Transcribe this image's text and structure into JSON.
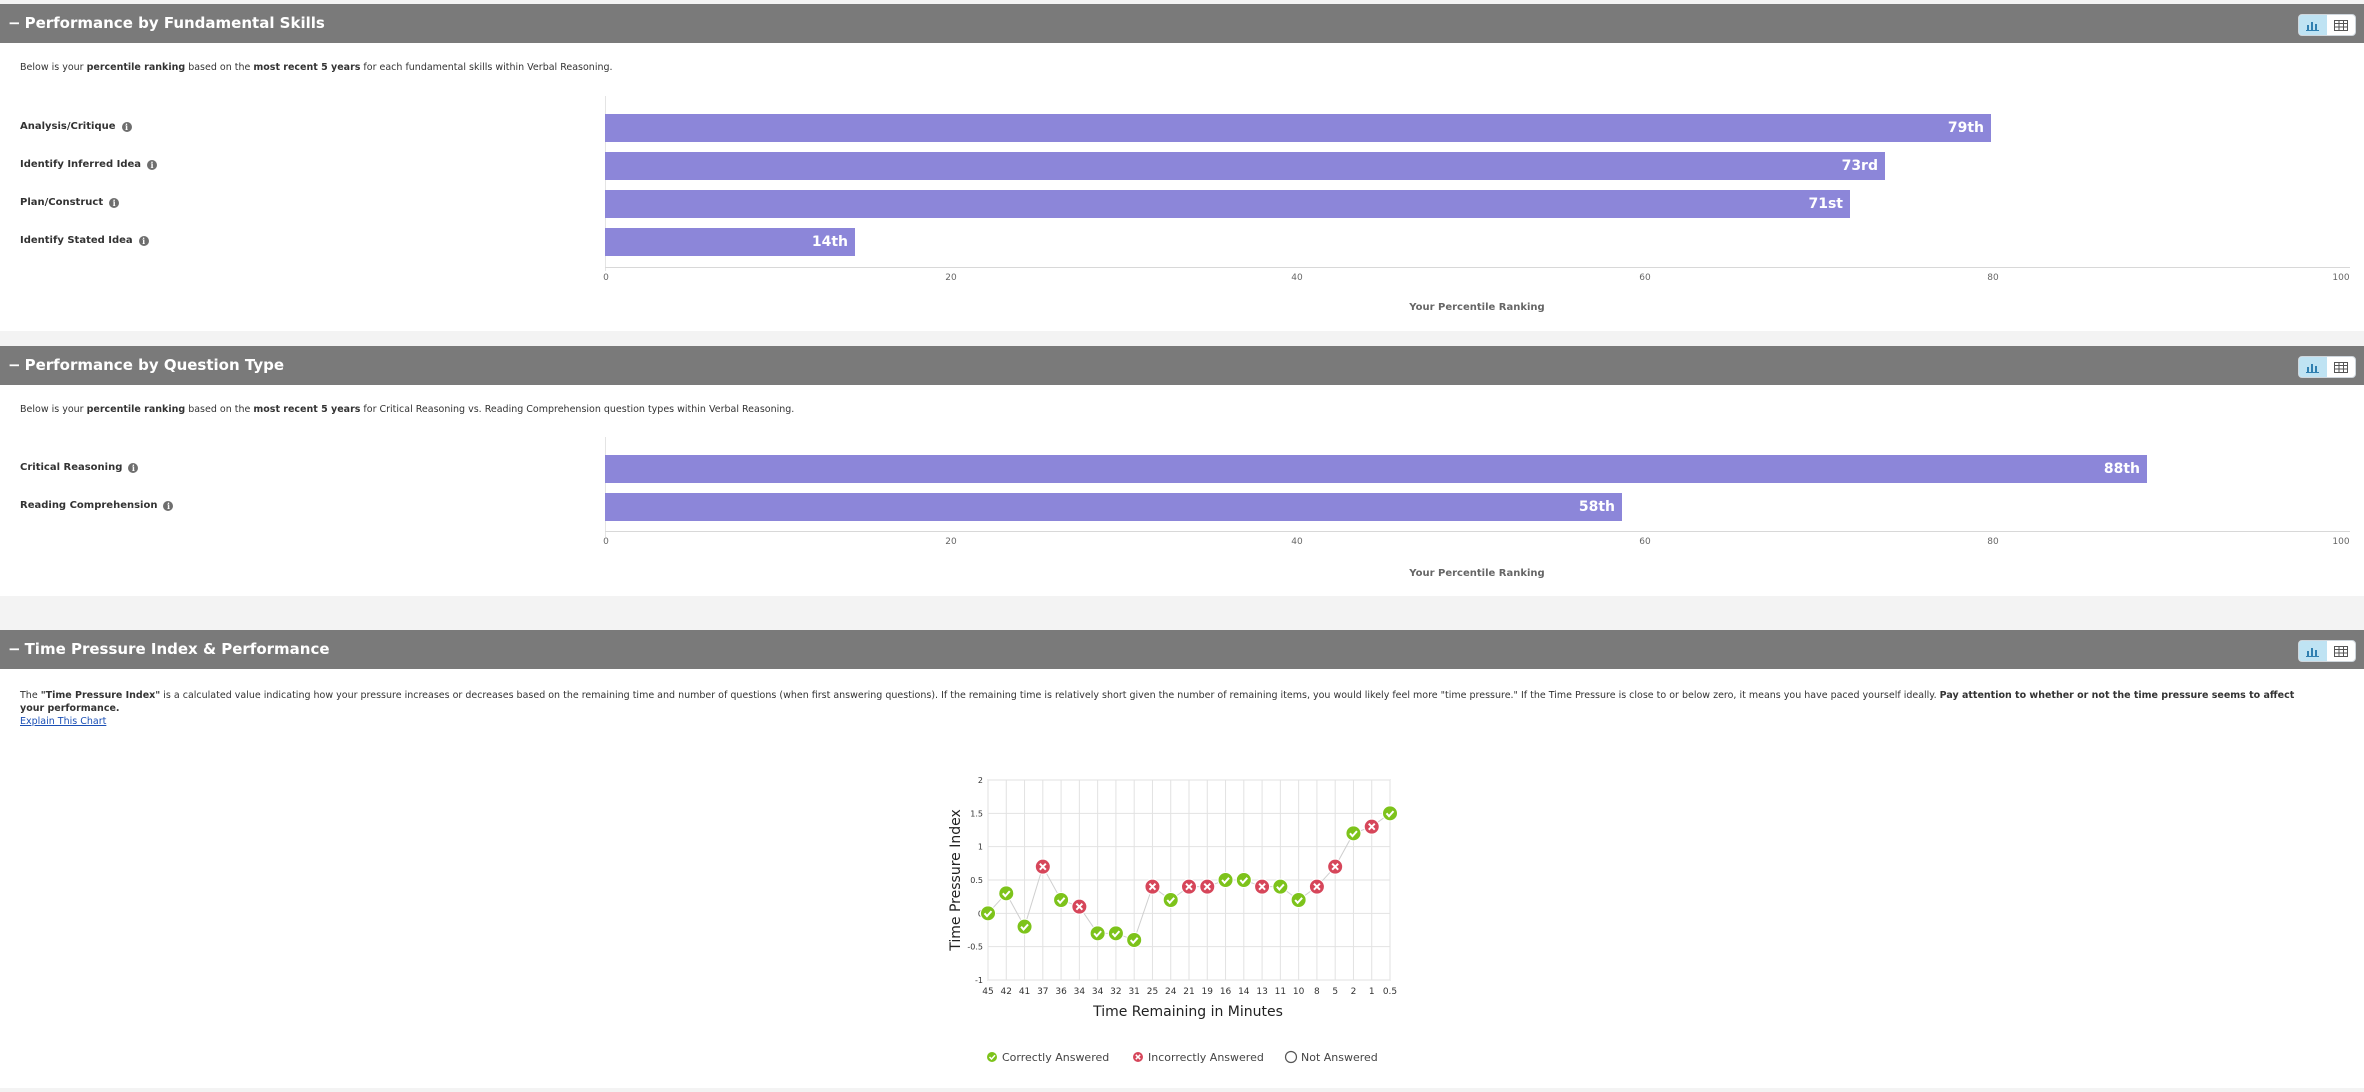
{
  "panels": [
    {
      "title": "Performance by Fundamental Skills",
      "desc_pre": "Below is your ",
      "desc_b1": "percentile ranking",
      "desc_mid": " based on the ",
      "desc_b2": "most recent 5 years",
      "desc_post": " for each fundamental skills within Verbal Reasoning.",
      "rows": [
        {
          "label": "Analysis/Critique",
          "value": 79,
          "rank": "79th"
        },
        {
          "label": "Identify Inferred Idea",
          "value": 73,
          "rank": "73rd"
        },
        {
          "label": "Plan/Construct",
          "value": 71,
          "rank": "71st"
        },
        {
          "label": "Identify Stated Idea",
          "value": 14,
          "rank": "14th"
        }
      ],
      "axis_title": "Your Percentile Ranking"
    },
    {
      "title": "Performance by Question Type",
      "desc_pre": "Below is your ",
      "desc_b1": "percentile ranking",
      "desc_mid": " based on the ",
      "desc_b2": "most recent 5 years",
      "desc_post": " for Critical Reasoning vs. Reading Comprehension question types within Verbal Reasoning.",
      "rows": [
        {
          "label": "Critical Reasoning",
          "value": 88,
          "rank": "88th"
        },
        {
          "label": "Reading Comprehension",
          "value": 58,
          "rank": "58th"
        }
      ],
      "axis_title": "Your Percentile Ranking"
    },
    {
      "title": "Time Pressure Index & Performance",
      "text_pre": "The ",
      "text_b1": "\"Time Pressure Index\"",
      "text_mid": " is a calculated value indicating how your pressure increases or decreases based on the remaining time and number of questions (when first answering questions). If the remaining time is relatively short given the number of remaining items, you would likely feel more \"time pressure.\" If the Time Pressure is close to or below zero, it means you have paced yourself ideally. ",
      "text_b2": "Pay attention to whether or not the time pressure seems to affect your performance.",
      "link": "Explain This Chart"
    }
  ],
  "percentile_ticks": [
    "0",
    "20",
    "40",
    "60",
    "80",
    "100"
  ],
  "colors": {
    "header": "#7a7a7a",
    "bar": "#8c86d9",
    "correct": "#7dc31b",
    "incorrect": "#d6465a",
    "toggle_active": "#bfe3f3"
  },
  "icons": {
    "collapse": "minus-icon",
    "chart_view": "bar-chart-icon",
    "table_view": "table-icon",
    "info": "info-icon"
  },
  "chart_data": {
    "type": "scatter",
    "ylabel": "Time Pressure Index",
    "xlabel": "Time Remaining in Minutes",
    "ylim": [
      -1,
      2
    ],
    "yticks": [
      "2",
      "1.5",
      "1",
      "0.5",
      "0",
      "-0.5",
      "-1"
    ],
    "x": [
      "45",
      "42",
      "41",
      "37",
      "36",
      "34",
      "34",
      "32",
      "31",
      "25",
      "24",
      "21",
      "19",
      "16",
      "14",
      "13",
      "11",
      "10",
      "8",
      "5",
      "2",
      "1",
      "0.5"
    ],
    "y": [
      0.0,
      0.3,
      -0.2,
      0.7,
      0.2,
      0.1,
      -0.3,
      -0.3,
      -0.4,
      0.4,
      0.2,
      0.4,
      0.4,
      0.5,
      0.5,
      0.4,
      0.4,
      0.2,
      0.4,
      0.7,
      1.2,
      1.3,
      1.5
    ],
    "status": [
      "correct",
      "correct",
      "correct",
      "incorrect",
      "correct",
      "incorrect",
      "correct",
      "correct",
      "correct",
      "incorrect",
      "correct",
      "incorrect",
      "incorrect",
      "correct",
      "correct",
      "incorrect",
      "correct",
      "correct",
      "incorrect",
      "incorrect",
      "correct",
      "incorrect",
      "correct"
    ],
    "legend": [
      "Correctly Answered",
      "Incorrectly Answered",
      "Not Answered"
    ],
    "grid": true
  }
}
